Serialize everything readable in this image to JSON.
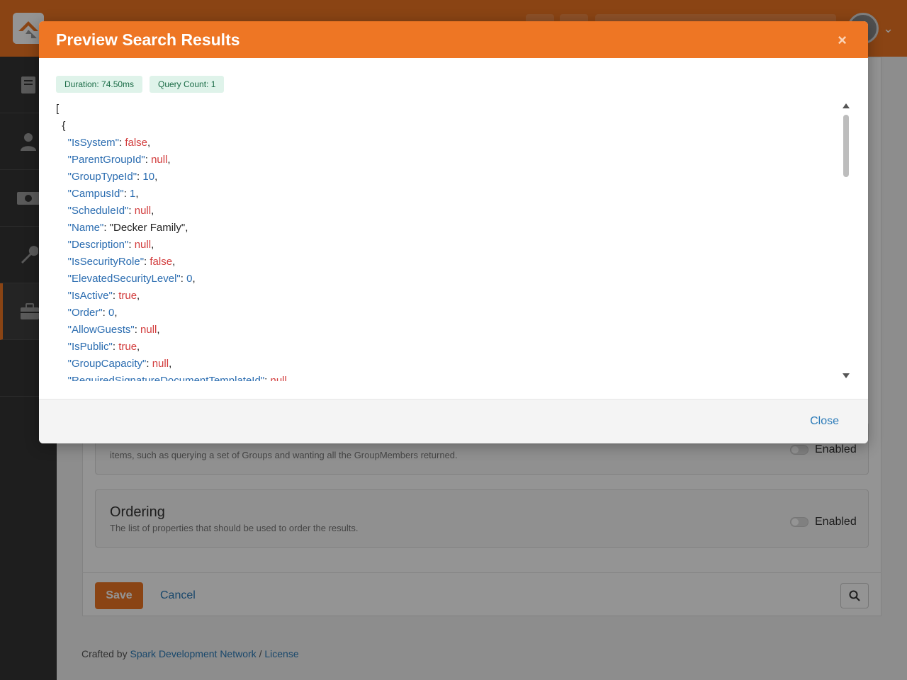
{
  "page": {
    "features": [
      {
        "title": "",
        "description": "items, such as querying a set of Groups and wanting all the GroupMembers returned.",
        "toggle_label": "Enabled"
      },
      {
        "title": "Ordering",
        "description": "The list of properties that should be used to order the results.",
        "toggle_label": "Enabled"
      }
    ],
    "save_label": "Save",
    "cancel_label": "Cancel",
    "footer": {
      "crafted_by": "Crafted by",
      "network_link": "Spark Development Network",
      "separator": "/",
      "license_link": "License"
    }
  },
  "modal": {
    "title": "Preview Search Results",
    "close_x": "×",
    "badges": {
      "duration": "Duration: 74.50ms",
      "query_count": "Query Count: 1"
    },
    "json_lines": [
      {
        "indent": "",
        "raw": "["
      },
      {
        "indent": "  ",
        "raw": "{"
      },
      {
        "indent": "    ",
        "key": "IsSystem",
        "value": "false",
        "kind": "kw"
      },
      {
        "indent": "    ",
        "key": "ParentGroupId",
        "value": "null",
        "kind": "kw"
      },
      {
        "indent": "    ",
        "key": "GroupTypeId",
        "value": "10",
        "kind": "num"
      },
      {
        "indent": "    ",
        "key": "CampusId",
        "value": "1",
        "kind": "num"
      },
      {
        "indent": "    ",
        "key": "ScheduleId",
        "value": "null",
        "kind": "kw"
      },
      {
        "indent": "    ",
        "key": "Name",
        "value": "\"Decker Family\"",
        "kind": "str"
      },
      {
        "indent": "    ",
        "key": "Description",
        "value": "null",
        "kind": "kw"
      },
      {
        "indent": "    ",
        "key": "IsSecurityRole",
        "value": "false",
        "kind": "kw"
      },
      {
        "indent": "    ",
        "key": "ElevatedSecurityLevel",
        "value": "0",
        "kind": "num"
      },
      {
        "indent": "    ",
        "key": "IsActive",
        "value": "true",
        "kind": "kw"
      },
      {
        "indent": "    ",
        "key": "Order",
        "value": "0",
        "kind": "num"
      },
      {
        "indent": "    ",
        "key": "AllowGuests",
        "value": "null",
        "kind": "kw"
      },
      {
        "indent": "    ",
        "key": "IsPublic",
        "value": "true",
        "kind": "kw"
      },
      {
        "indent": "    ",
        "key": "GroupCapacity",
        "value": "null",
        "kind": "kw"
      },
      {
        "indent": "    ",
        "key": "RequiredSignatureDocumentTemplateId",
        "value": "null",
        "kind": "kw"
      }
    ],
    "close_label": "Close"
  },
  "colors": {
    "brand": "#ee7624",
    "sidebar": "#343434",
    "link": "#2a7ab8",
    "json_key": "#2a6cb0",
    "json_keyword": "#d23c3c"
  },
  "icons": {
    "sidebar": [
      "book-icon",
      "person-icon",
      "money-icon",
      "wrench-icon",
      "briefcase-icon"
    ]
  }
}
